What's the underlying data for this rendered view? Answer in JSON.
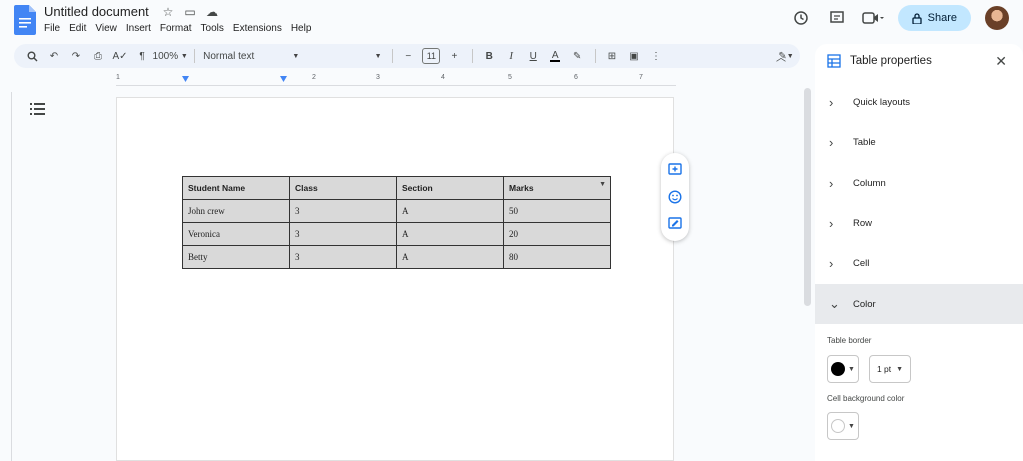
{
  "doc": {
    "title": "Untitled document",
    "menu": [
      "File",
      "Edit",
      "View",
      "Insert",
      "Format",
      "Tools",
      "Extensions",
      "Help"
    ],
    "share_label": "Share"
  },
  "toolbar": {
    "zoom": "100%",
    "style": "Normal text",
    "font_size": "11",
    "minus": "−",
    "plus": "+",
    "bold": "B",
    "italic": "I",
    "underline": "U",
    "text_color": "A"
  },
  "ruler": [
    "1",
    "2",
    "3",
    "4",
    "5",
    "6",
    "7"
  ],
  "table": {
    "headers": [
      "Student Name",
      "Class",
      "Section",
      "Marks"
    ],
    "rows": [
      [
        "John crew",
        "3",
        "A",
        "50"
      ],
      [
        "Veronica",
        "3",
        "A",
        "20"
      ],
      [
        "Betty",
        "3",
        "A",
        "80"
      ]
    ]
  },
  "panel": {
    "title": "Table properties",
    "sections": [
      "Quick layouts",
      "Table",
      "Column",
      "Row",
      "Cell",
      "Color"
    ],
    "table_border_label": "Table border",
    "border_width": "1 pt",
    "cell_bg_label": "Cell background color"
  },
  "colors": {
    "accent": "#4285f4",
    "share_bg": "#c2e7ff",
    "table_fill": "#d9d9d9",
    "border_color": "#000000"
  }
}
